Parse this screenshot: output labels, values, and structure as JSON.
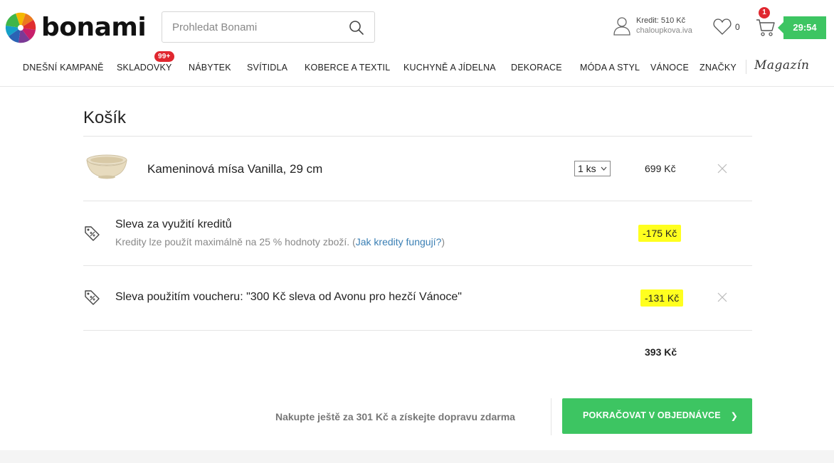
{
  "brand": {
    "name": "bonami"
  },
  "search": {
    "placeholder": "Prohledat Bonami"
  },
  "account": {
    "credit": "Kredit: 510 Kč",
    "username": "chaloupkova.iva"
  },
  "wishlist": {
    "count": "0"
  },
  "cart_icon": {
    "badge": "1"
  },
  "timer": {
    "value": "29:54"
  },
  "nav": {
    "items": [
      "DNEŠNÍ KAMPANĚ",
      "SKLADOVKY",
      "NÁBYTEK",
      "SVÍTIDLA",
      "KOBERCE A TEXTIL",
      "KUCHYNĚ A JÍDELNA",
      "DEKORACE",
      "MÓDA A STYL",
      "VÁNOCE",
      "ZNAČKY"
    ],
    "skladovky_badge": "99+",
    "magazin": "Magazín"
  },
  "cart": {
    "title": "Košík",
    "product": {
      "name": "Kameninová mísa Vanilla, 29 cm",
      "quantity": "1 ks",
      "price": "699 Kč"
    },
    "credit_discount": {
      "title": "Sleva za využití kreditů",
      "note": "Kredity lze použít maximálně na 25 % hodnoty zboží. (",
      "note_link": "Jak kredity fungují?",
      "note_end": ")",
      "amount": "-175 Kč"
    },
    "voucher_discount": {
      "title": "Sleva použitím voucheru: \"300 Kč sleva od Avonu pro hezčí Vánoce\"",
      "amount": "-131 Kč"
    },
    "total": "393 Kč",
    "free_shipping": "Nakupte ještě za 301 Kč a získejte dopravu zdarma",
    "continue_label": "POKRAČOVAT V OBJEDNÁVCE",
    "continue_arrow": "❯"
  },
  "colors": {
    "accent_green": "#3dc562",
    "badge_red": "#e0272f",
    "highlight": "#ffff1f",
    "link": "#3a7fb4"
  }
}
